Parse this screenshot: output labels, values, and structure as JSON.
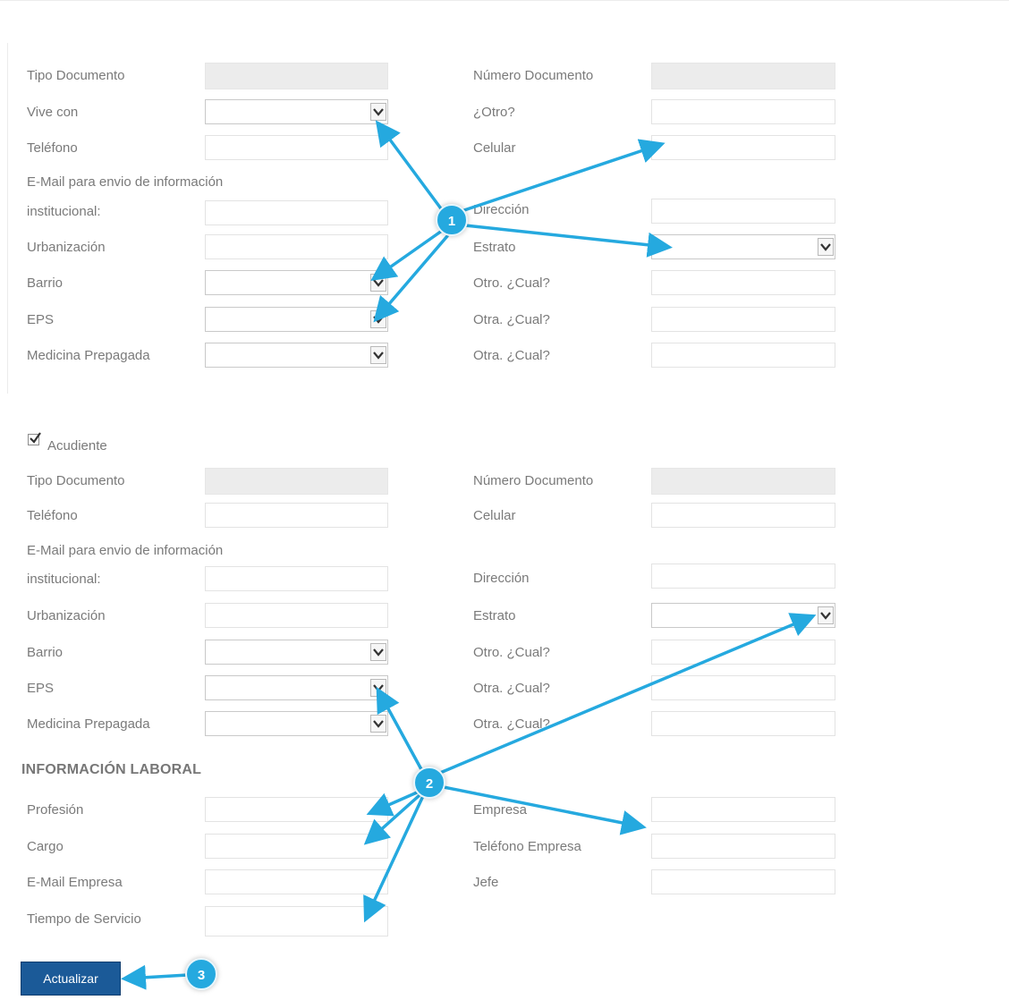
{
  "section1": {
    "labels": {
      "tipo_documento": "Tipo Documento",
      "numero_documento": "Número Documento",
      "vive_con": "Vive con",
      "otro": "¿Otro?",
      "telefono": "Teléfono",
      "celular": "Celular",
      "email_line1": "E-Mail para envio de información",
      "email_line2": "institucional:",
      "direccion": "Dirección",
      "urbanizacion": "Urbanización",
      "estrato": "Estrato",
      "barrio": "Barrio",
      "otro_cual": "Otro. ¿Cual?",
      "eps": "EPS",
      "otra_cual_1": "Otra. ¿Cual?",
      "medicina_prepagada": "Medicina Prepagada",
      "otra_cual_2": "Otra. ¿Cual?"
    }
  },
  "acudiente": {
    "checkbox_label": "Acudiente",
    "checked": true,
    "labels": {
      "tipo_documento": "Tipo Documento",
      "numero_documento": "Número Documento",
      "telefono": "Teléfono",
      "celular": "Celular",
      "email_line1": "E-Mail para envio de información",
      "email_line2": "institucional:",
      "direccion": "Dirección",
      "urbanizacion": "Urbanización",
      "estrato": "Estrato",
      "barrio": "Barrio",
      "otro_cual": "Otro. ¿Cual?",
      "eps": "EPS",
      "otra_cual_1": "Otra. ¿Cual?",
      "medicina_prepagada": "Medicina Prepagada",
      "otra_cual_2": "Otra. ¿Cual?"
    }
  },
  "laboral": {
    "title": "INFORMACIÓN LABORAL",
    "labels": {
      "profesion": "Profesión",
      "empresa": "Empresa",
      "cargo": "Cargo",
      "telefono_empresa": "Teléfono Empresa",
      "email_empresa": "E-Mail Empresa",
      "jefe": "Jefe",
      "tiempo_servicio": "Tiempo de Servicio"
    }
  },
  "actions": {
    "update_label": "Actualizar"
  },
  "callouts": {
    "badge_1": "1",
    "badge_2": "2",
    "badge_3": "3",
    "color": "#25a9df"
  }
}
